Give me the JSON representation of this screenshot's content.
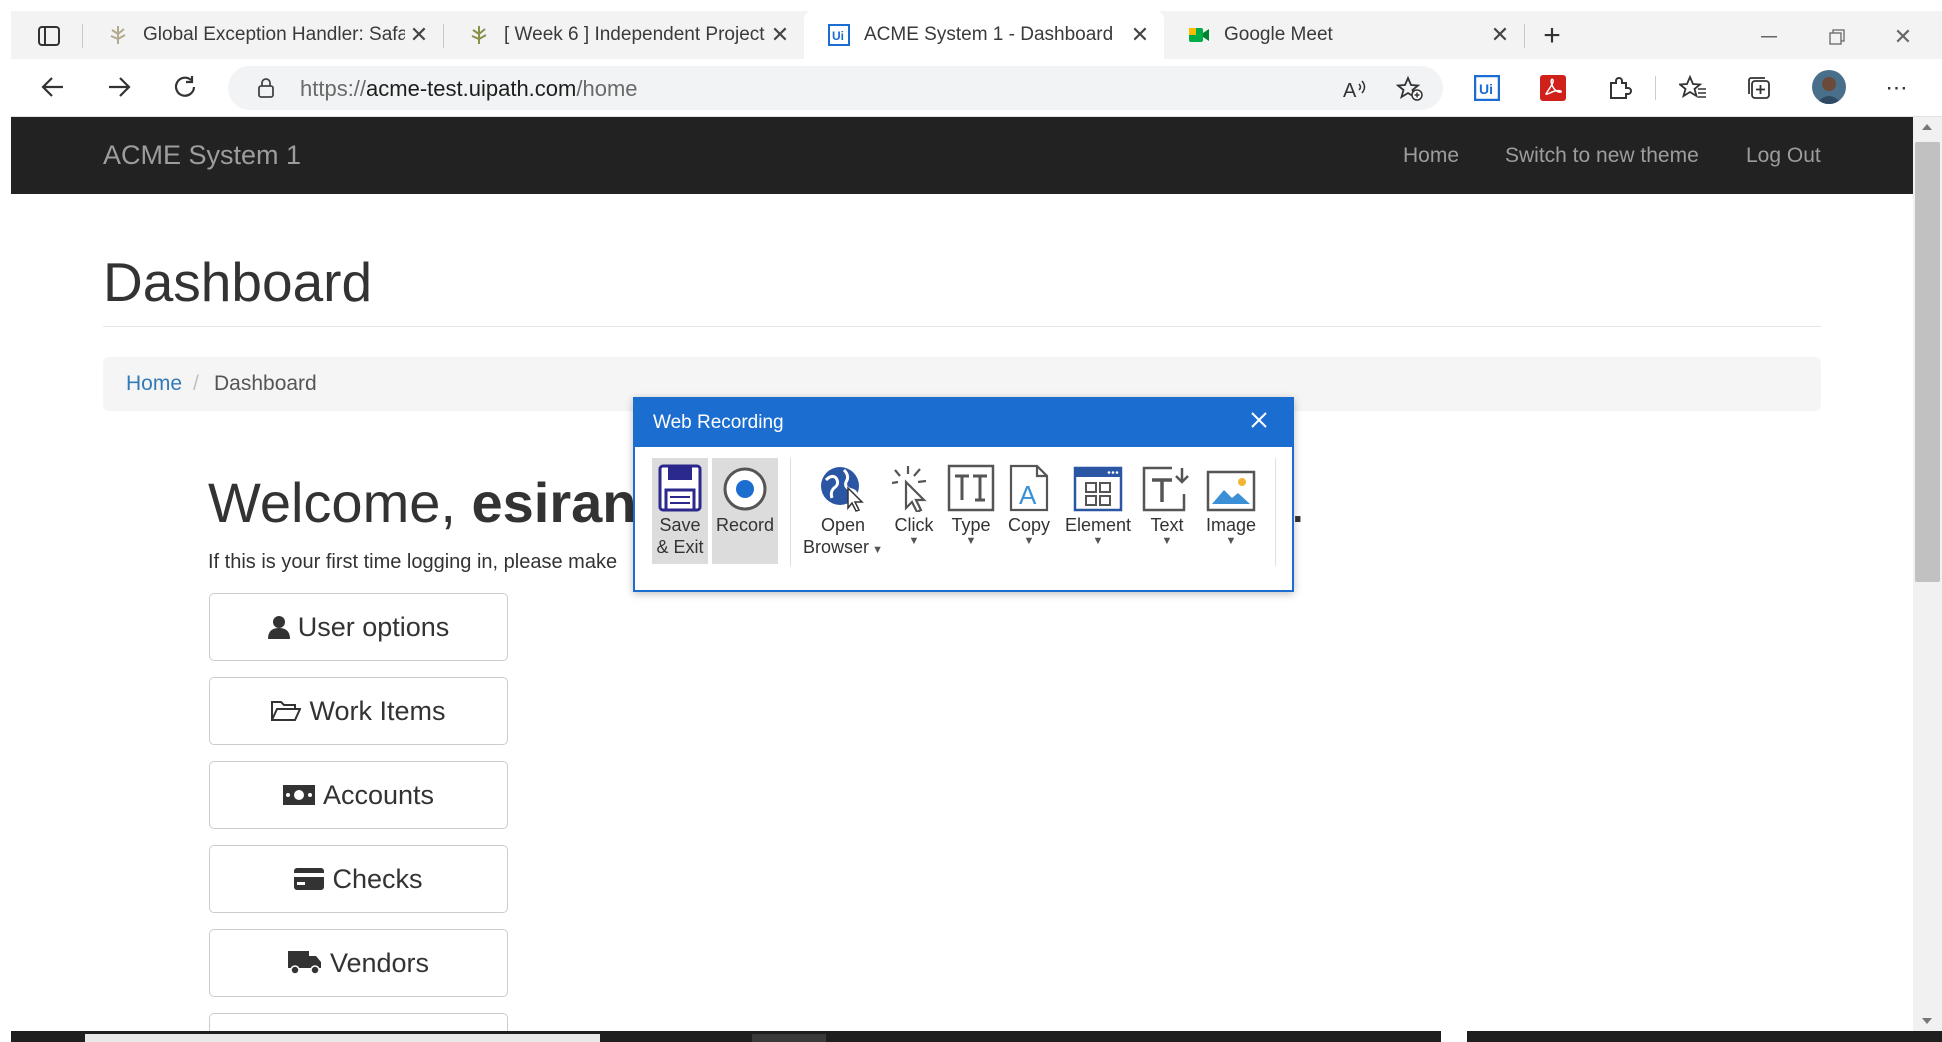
{
  "browser": {
    "tabs": [
      {
        "title": "Global Exception Handler: Safari",
        "icon": "uipath-forum-icon",
        "active": false
      },
      {
        "title": "[ Week 6 ] Independent Project",
        "icon": "uipath-forum-icon",
        "active": false
      },
      {
        "title": "ACME System 1 - Dashboard",
        "icon": "uipath-ui-icon",
        "active": true
      },
      {
        "title": "Google Meet",
        "icon": "google-meet-icon",
        "active": false
      }
    ],
    "url_scheme": "https://",
    "url_host": "acme-test.uipath.com",
    "url_path": "/home"
  },
  "navbar": {
    "brand": "ACME System 1",
    "links": [
      "Home",
      "Switch to new theme",
      "Log Out"
    ]
  },
  "page": {
    "title": "Dashboard",
    "breadcrumb": {
      "home": "Home",
      "separator": "/",
      "current": "Dashboard"
    },
    "welcome_prefix": "Welcome, ",
    "welcome_name": "esiranj",
    "welcome_suffix": ".",
    "subtext": "If this is your first time logging in, please make",
    "buttons": [
      {
        "label": "User options",
        "icon": "user-icon"
      },
      {
        "label": "Work Items",
        "icon": "folder-open-icon"
      },
      {
        "label": "Accounts",
        "icon": "money-icon"
      },
      {
        "label": "Checks",
        "icon": "credit-card-icon"
      },
      {
        "label": "Vendors",
        "icon": "truck-icon"
      }
    ]
  },
  "recorder": {
    "title": "Web Recording",
    "save_line1": "Save",
    "save_line2": "& Exit",
    "record": "Record",
    "open_line1": "Open",
    "open_line2": "Browser",
    "click": "Click",
    "type": "Type",
    "copy": "Copy",
    "element": "Element",
    "text": "Text",
    "image": "Image"
  },
  "colors": {
    "navbar_bg": "#222222",
    "link": "#337ab7",
    "recorder_accent": "#1c6dd0"
  }
}
